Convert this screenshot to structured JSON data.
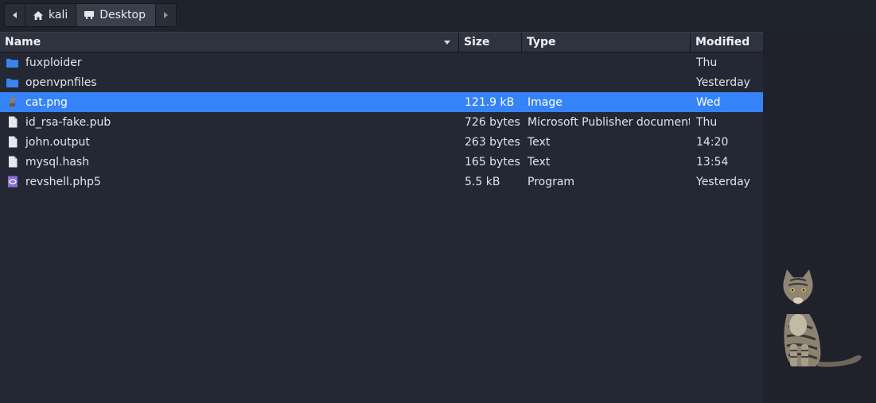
{
  "pathbar": {
    "back_icon": "chevron-left-icon",
    "crumbs": [
      {
        "label": "kali",
        "icon": "home-icon"
      },
      {
        "label": "Desktop",
        "icon": "desktop-icon"
      }
    ],
    "forward_icon": "chevron-right-icon"
  },
  "columns": {
    "name": "Name",
    "size": "Size",
    "type": "Type",
    "modified": "Modified"
  },
  "files": [
    {
      "name": "fuxploider",
      "size": "",
      "type": "",
      "modified": "Thu",
      "icon": "folder-icon",
      "selected": false
    },
    {
      "name": "openvpnfiles",
      "size": "",
      "type": "",
      "modified": "Yesterday",
      "icon": "folder-icon",
      "selected": false
    },
    {
      "name": "cat.png",
      "size": "121.9 kB",
      "type": "Image",
      "modified": "Wed",
      "icon": "image-thumbnail-icon",
      "selected": true
    },
    {
      "name": "id_rsa-fake.pub",
      "size": "726 bytes",
      "type": "Microsoft Publisher document",
      "modified": "Thu",
      "icon": "text-file-icon",
      "selected": false
    },
    {
      "name": "john.output",
      "size": "263 bytes",
      "type": "Text",
      "modified": "14:20",
      "icon": "text-file-icon",
      "selected": false
    },
    {
      "name": "mysql.hash",
      "size": "165 bytes",
      "type": "Text",
      "modified": "13:54",
      "icon": "text-file-icon",
      "selected": false
    },
    {
      "name": "revshell.php5",
      "size": "5.5 kB",
      "type": "Program",
      "modified": "Yesterday",
      "icon": "php-icon",
      "selected": false
    }
  ],
  "colors": {
    "selection": "#3583f6",
    "folder": "#3b84f0",
    "php": "#8a6fd6"
  },
  "preview": {
    "image": "cat-preview-image"
  }
}
